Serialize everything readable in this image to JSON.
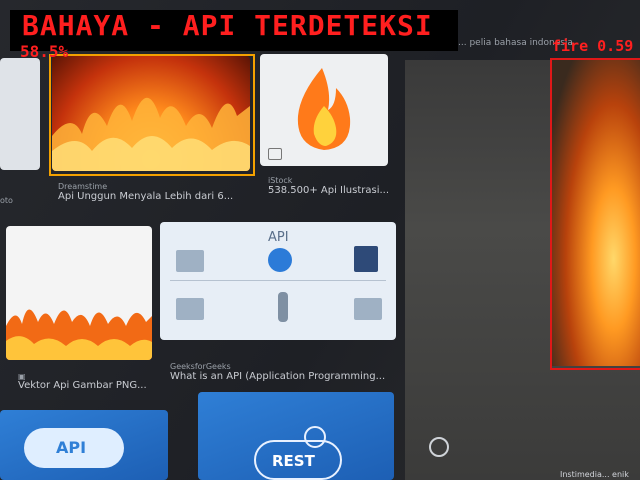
{
  "alert": {
    "banner_text": "BAHAYA - API TERDETEKSI",
    "confidence_text": "58.5%"
  },
  "detections": [
    {
      "label": "fire 0.59",
      "color": "#e01818"
    }
  ],
  "top_caption": "... pelia bahasa indonesia",
  "results": [
    {
      "source": "Dreamstime",
      "title": "Api Unggun Menyala Lebih dari 6..."
    },
    {
      "source": "iStock",
      "title": "538.500+ Api Ilustrasi..."
    },
    {
      "source": "",
      "title": "Vektor Api Gambar PNG..."
    },
    {
      "source": "GeeksforGeeks",
      "title": "What is an API (Application Programming..."
    }
  ],
  "api_diagram_title": "API",
  "tiles": {
    "cloud_api_label": "API",
    "rest_label": "REST"
  },
  "bottom_caption": "Instimedia... enik",
  "colors": {
    "alert_red": "#ff1f1f",
    "highlight_orange": "#f3a100",
    "fire_orange": "#ff8a1c"
  }
}
